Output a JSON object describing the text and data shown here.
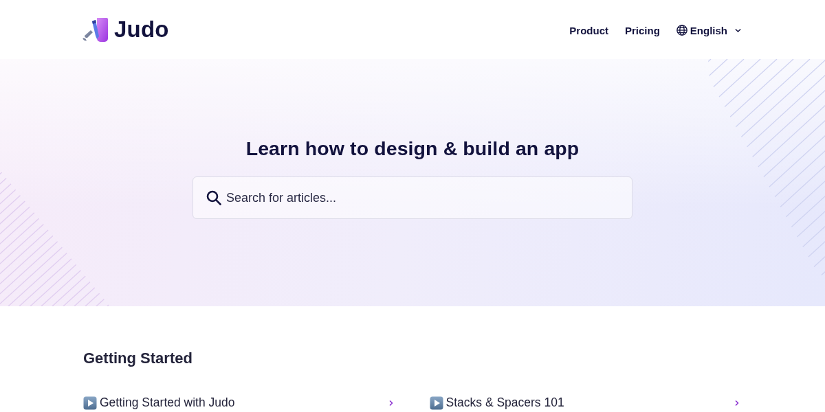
{
  "header": {
    "logo": {
      "text": "Judo"
    },
    "nav": [
      {
        "label": "Product",
        "kind": "link"
      },
      {
        "label": "Pricing",
        "kind": "link"
      },
      {
        "label": "English",
        "kind": "language"
      }
    ]
  },
  "hero": {
    "title": "Learn how to design & build an app",
    "search": {
      "placeholder": "Search for articles..."
    }
  },
  "sections": [
    {
      "title": "Getting Started",
      "articles": [
        {
          "title": "Getting Started with Judo"
        },
        {
          "title": "Stacks & Spacers 101"
        }
      ]
    }
  ]
}
